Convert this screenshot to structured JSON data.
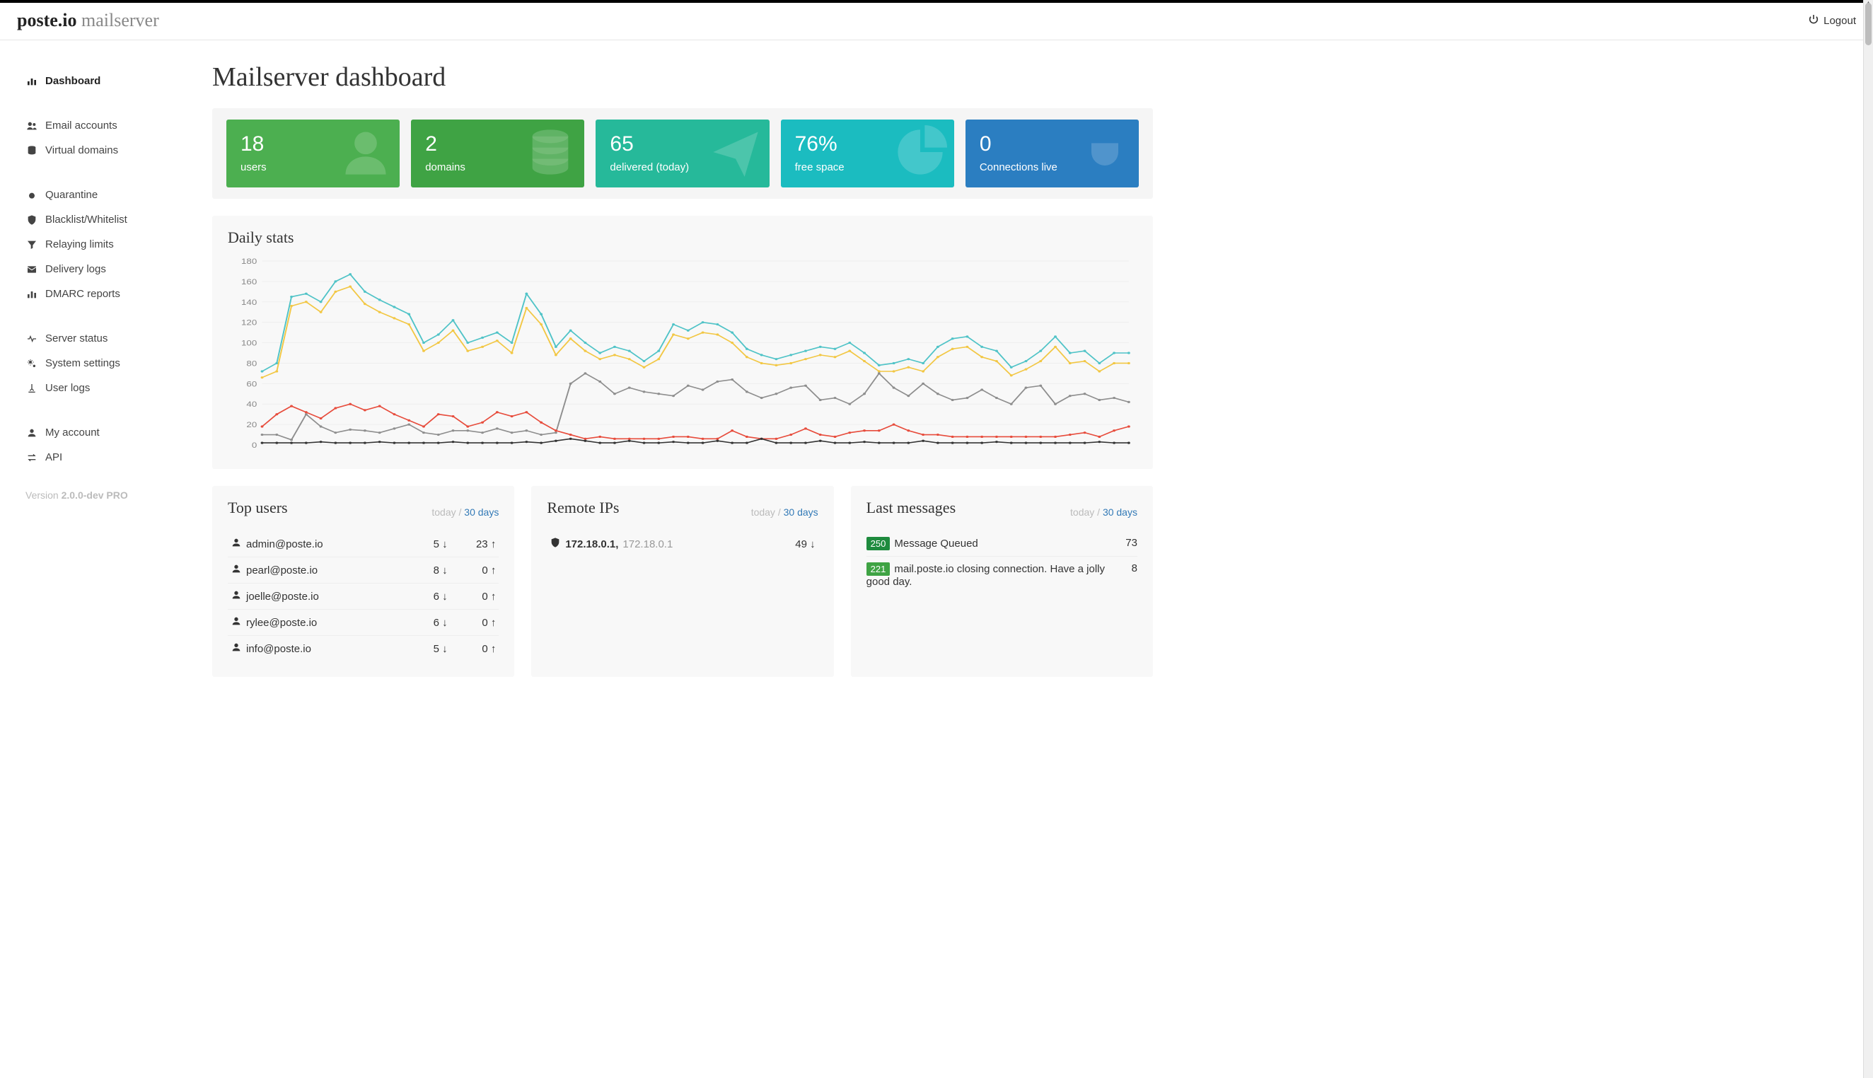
{
  "brand": {
    "name": "poste.io",
    "sub": "mailserver"
  },
  "logout_label": "Logout",
  "sidebar": {
    "groups": [
      [
        {
          "icon": "bar-chart",
          "label": "Dashboard",
          "active": true
        }
      ],
      [
        {
          "icon": "users",
          "label": "Email accounts"
        },
        {
          "icon": "database",
          "label": "Virtual domains"
        }
      ],
      [
        {
          "icon": "bug",
          "label": "Quarantine"
        },
        {
          "icon": "shield",
          "label": "Blacklist/Whitelist"
        },
        {
          "icon": "filter",
          "label": "Relaying limits"
        },
        {
          "icon": "envelope",
          "label": "Delivery logs"
        },
        {
          "icon": "bar-chart",
          "label": "DMARC reports"
        }
      ],
      [
        {
          "icon": "heartbeat",
          "label": "Server status"
        },
        {
          "icon": "gears",
          "label": "System settings"
        },
        {
          "icon": "log",
          "label": "User logs"
        }
      ],
      [
        {
          "icon": "user",
          "label": "My account"
        },
        {
          "icon": "transfer",
          "label": "API"
        }
      ]
    ],
    "version_prefix": "Version ",
    "version": "2.0.0-dev PRO"
  },
  "page_title": "Mailserver dashboard",
  "cards": [
    {
      "value": "18",
      "label": "users",
      "color": "c-green1",
      "icon": "user-big"
    },
    {
      "value": "2",
      "label": "domains",
      "color": "c-green2",
      "icon": "db-big"
    },
    {
      "value": "65",
      "label": "delivered (today)",
      "color": "c-teal",
      "icon": "plane-big"
    },
    {
      "value": "76%",
      "label": "free space",
      "color": "c-cyan",
      "icon": "pie-big"
    },
    {
      "value": "0",
      "label": "Connections live",
      "color": "c-blue",
      "icon": "plug-big"
    }
  ],
  "daily_stats_title": "Daily stats",
  "chart_data": {
    "type": "line",
    "xlabel": "",
    "ylabel": "",
    "ylim": [
      0,
      180
    ],
    "y_ticks": [
      0,
      20,
      40,
      60,
      80,
      100,
      120,
      140,
      160,
      180
    ],
    "n_points": 60,
    "series": [
      {
        "name": "series-teal",
        "color": "#4fc3c7",
        "values": [
          72,
          80,
          145,
          148,
          140,
          160,
          167,
          150,
          142,
          135,
          128,
          100,
          108,
          122,
          100,
          105,
          110,
          100,
          148,
          128,
          96,
          112,
          100,
          90,
          96,
          92,
          82,
          92,
          118,
          112,
          120,
          118,
          110,
          94,
          88,
          84,
          88,
          92,
          96,
          94,
          100,
          90,
          78,
          80,
          84,
          80,
          96,
          104,
          106,
          96,
          92,
          76,
          82,
          92,
          106,
          90,
          92,
          80,
          90,
          90
        ]
      },
      {
        "name": "series-yellow",
        "color": "#f2c744",
        "values": [
          66,
          72,
          136,
          140,
          130,
          150,
          155,
          138,
          130,
          124,
          118,
          92,
          100,
          112,
          92,
          96,
          102,
          90,
          134,
          118,
          88,
          104,
          92,
          84,
          88,
          84,
          76,
          84,
          108,
          104,
          110,
          108,
          100,
          86,
          80,
          78,
          80,
          84,
          88,
          86,
          92,
          82,
          72,
          72,
          76,
          72,
          86,
          94,
          96,
          86,
          82,
          68,
          74,
          82,
          96,
          80,
          82,
          72,
          80,
          80
        ]
      },
      {
        "name": "series-grey",
        "color": "#8e8e8e",
        "values": [
          10,
          10,
          5,
          30,
          18,
          12,
          15,
          14,
          12,
          16,
          20,
          12,
          10,
          14,
          14,
          12,
          16,
          12,
          14,
          10,
          12,
          60,
          70,
          62,
          50,
          56,
          52,
          50,
          48,
          58,
          54,
          62,
          64,
          52,
          46,
          50,
          56,
          58,
          44,
          46,
          40,
          50,
          70,
          56,
          48,
          60,
          50,
          44,
          46,
          54,
          46,
          40,
          56,
          58,
          40,
          48,
          50,
          44,
          46,
          42
        ]
      },
      {
        "name": "series-red",
        "color": "#e74c3c",
        "values": [
          18,
          30,
          38,
          32,
          26,
          36,
          40,
          34,
          38,
          30,
          24,
          18,
          30,
          28,
          18,
          22,
          32,
          28,
          32,
          22,
          14,
          10,
          6,
          8,
          6,
          6,
          6,
          6,
          8,
          8,
          6,
          6,
          14,
          8,
          6,
          6,
          10,
          16,
          10,
          8,
          12,
          14,
          14,
          20,
          14,
          10,
          10,
          8,
          8,
          8,
          8,
          8,
          8,
          8,
          8,
          10,
          12,
          8,
          14,
          18
        ]
      },
      {
        "name": "series-black",
        "color": "#333333",
        "values": [
          2,
          2,
          2,
          2,
          3,
          2,
          2,
          2,
          3,
          2,
          2,
          2,
          2,
          3,
          2,
          2,
          2,
          2,
          3,
          2,
          4,
          6,
          4,
          2,
          2,
          4,
          2,
          2,
          3,
          2,
          2,
          4,
          2,
          2,
          6,
          2,
          2,
          2,
          4,
          2,
          2,
          3,
          2,
          2,
          2,
          4,
          2,
          2,
          2,
          2,
          3,
          2,
          2,
          2,
          2,
          2,
          2,
          3,
          2,
          2
        ]
      }
    ]
  },
  "range_labels": {
    "today": "today",
    "sep": " / ",
    "days30": "30 days"
  },
  "top_users": {
    "title": "Top users",
    "rows": [
      {
        "email": "admin@poste.io",
        "in": 5,
        "out": 23
      },
      {
        "email": "pearl@poste.io",
        "in": 8,
        "out": 0
      },
      {
        "email": "joelle@poste.io",
        "in": 6,
        "out": 0
      },
      {
        "email": "rylee@poste.io",
        "in": 6,
        "out": 0
      },
      {
        "email": "info@poste.io",
        "in": 5,
        "out": 0
      }
    ]
  },
  "remote_ips": {
    "title": "Remote IPs",
    "rows": [
      {
        "primary": "172.18.0.1,",
        "secondary": "172.18.0.1",
        "count": 49
      }
    ]
  },
  "last_messages": {
    "title": "Last messages",
    "rows": [
      {
        "badge": "250",
        "badge_class": "g1",
        "text": "Message Queued",
        "count": 73
      },
      {
        "badge": "221",
        "badge_class": "g2",
        "text": "mail.poste.io closing connection. Have a jolly good day.",
        "count": 8
      }
    ]
  }
}
